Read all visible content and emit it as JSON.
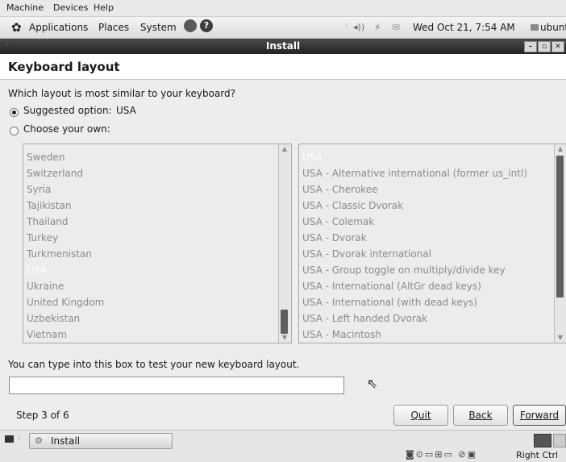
{
  "vm_menu": {
    "machine": "Machine",
    "devices": "Devices",
    "help": "Help"
  },
  "panel": {
    "applications": "Applications",
    "places": "Places",
    "system": "System",
    "datetime": "Wed Oct 21,  7:54 AM",
    "user": "ubuntu"
  },
  "window": {
    "title": "Install"
  },
  "page": {
    "heading": "Keyboard layout",
    "question": "Which layout is most similar to your keyboard?",
    "suggested_label": "Suggested option:",
    "suggested_value": "USA",
    "choose_label": "Choose your own:",
    "test_hint": "You can type into this box to test your new keyboard layout.",
    "test_value": "",
    "step": "Step 3 of 6"
  },
  "countries": [
    "Sweden",
    "Switzerland",
    "Syria",
    "Tajikistan",
    "Thailand",
    "Turkey",
    "Turkmenistan",
    "USA",
    "Ukraine",
    "United Kingdom",
    "Uzbekistan",
    "Vietnam"
  ],
  "countries_selected_index": 7,
  "variants": [
    "USA",
    "USA - Alternative international (former us_intl)",
    "USA - Cherokee",
    "USA - Classic Dvorak",
    "USA - Colemak",
    "USA - Dvorak",
    "USA - Dvorak international",
    "USA - Group toggle on multiply/divide key",
    "USA - International (AltGr dead keys)",
    "USA - International (with dead keys)",
    "USA - Left handed Dvorak",
    "USA - Macintosh"
  ],
  "variants_selected_index": 0,
  "buttons": {
    "quit": "Quit",
    "back": "Back",
    "forward": "Forward"
  },
  "taskbar": {
    "task_label": "Install"
  },
  "statusbar": {
    "host_key": "Right Ctrl"
  },
  "colors": {
    "selection": "#ffffff",
    "title_bg": "#2f2f2f"
  }
}
